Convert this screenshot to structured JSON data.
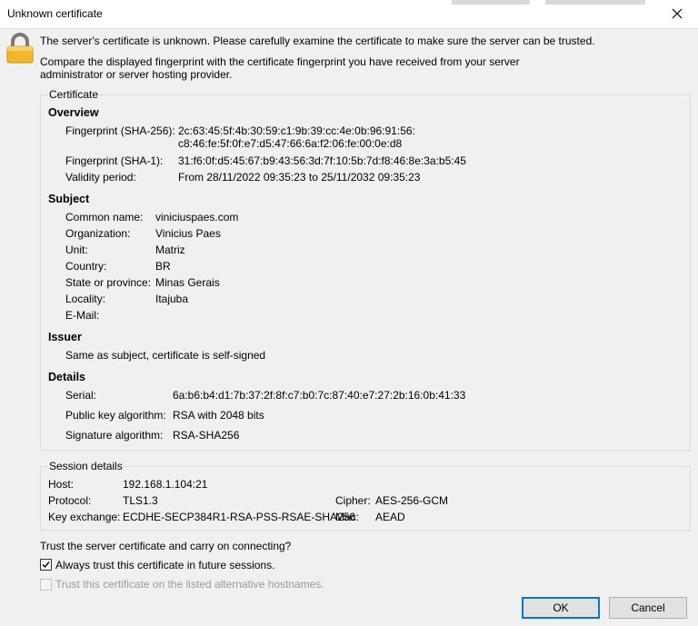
{
  "window": {
    "title": "Unknown certificate"
  },
  "header": {
    "line1": "The server's certificate is unknown. Please carefully examine the certificate to make sure the server can be trusted.",
    "line2a": "Compare the displayed fingerprint with the certificate fingerprint you have received from your server",
    "line2b": "administrator or server hosting provider."
  },
  "certificate": {
    "group_label": "Certificate",
    "overview": {
      "heading": "Overview",
      "sha256_label": "Fingerprint (SHA-256):",
      "sha256_value_1": "2c:63:45:5f:4b:30:59:c1:9b:39:cc:4e:0b:96:91:56:",
      "sha256_value_2": "c8:46:fe:5f:0f:e7:d5:47:66:6a:f2:06:fe:00:0e:d8",
      "sha1_label": "Fingerprint (SHA-1):",
      "sha1_value": "31:f6:0f:d5:45:67:b9:43:56:3d:7f:10:5b:7d:f8:46:8e:3a:b5:45",
      "validity_label": "Validity period:",
      "validity_value": "From 28/11/2022 09:35:23 to 25/11/2032 09:35:23"
    },
    "subject": {
      "heading": "Subject",
      "common_name_label": "Common name:",
      "common_name_value": "viniciuspaes.com",
      "organization_label": "Organization:",
      "organization_value": "Vinicius Paes",
      "unit_label": "Unit:",
      "unit_value": "Matriz",
      "country_label": "Country:",
      "country_value": "BR",
      "state_label": "State or province:",
      "state_value": "Minas Gerais",
      "locality_label": "Locality:",
      "locality_value": "Itajuba",
      "email_label": "E-Mail:"
    },
    "issuer": {
      "heading": "Issuer",
      "text": "Same as subject, certificate is self-signed"
    },
    "details": {
      "heading": "Details",
      "serial_label": "Serial:",
      "serial_value": "6a:b6:b4:d1:7b:37:2f:8f:c7:b0:7c:87:40:e7:27:2b:16:0b:41:33",
      "pubkey_label": "Public key algorithm:",
      "pubkey_value": "RSA with 2048 bits",
      "sig_label": "Signature algorithm:",
      "sig_value": "RSA-SHA256"
    }
  },
  "session": {
    "group_label": "Session details",
    "host_label": "Host:",
    "host_value": "192.168.1.104:21",
    "protocol_label": "Protocol:",
    "protocol_value": "TLS1.3",
    "cipher_label": "Cipher:",
    "cipher_value": "AES-256-GCM",
    "kex_label": "Key exchange:",
    "kex_value": "ECDHE-SECP384R1-RSA-PSS-RSAE-SHA256",
    "mac_label": "Mac:",
    "mac_value": "AEAD"
  },
  "trust": {
    "question": "Trust the server certificate and carry on connecting?",
    "always_trust_label": "Always trust this certificate in future sessions.",
    "always_trust_checked": true,
    "alt_hostnames_label": "Trust this certificate on the listed alternative hostnames.",
    "alt_hostnames_checked": false
  },
  "buttons": {
    "ok_label": "OK",
    "cancel_label": "Cancel"
  },
  "icons": {
    "lock": "padlock-icon",
    "close": "close-icon",
    "check": "checkmark-icon"
  },
  "colors": {
    "accent": "#0078d7",
    "lock_body": "#f0b72f",
    "lock_shackle": "#7a7a7a"
  }
}
